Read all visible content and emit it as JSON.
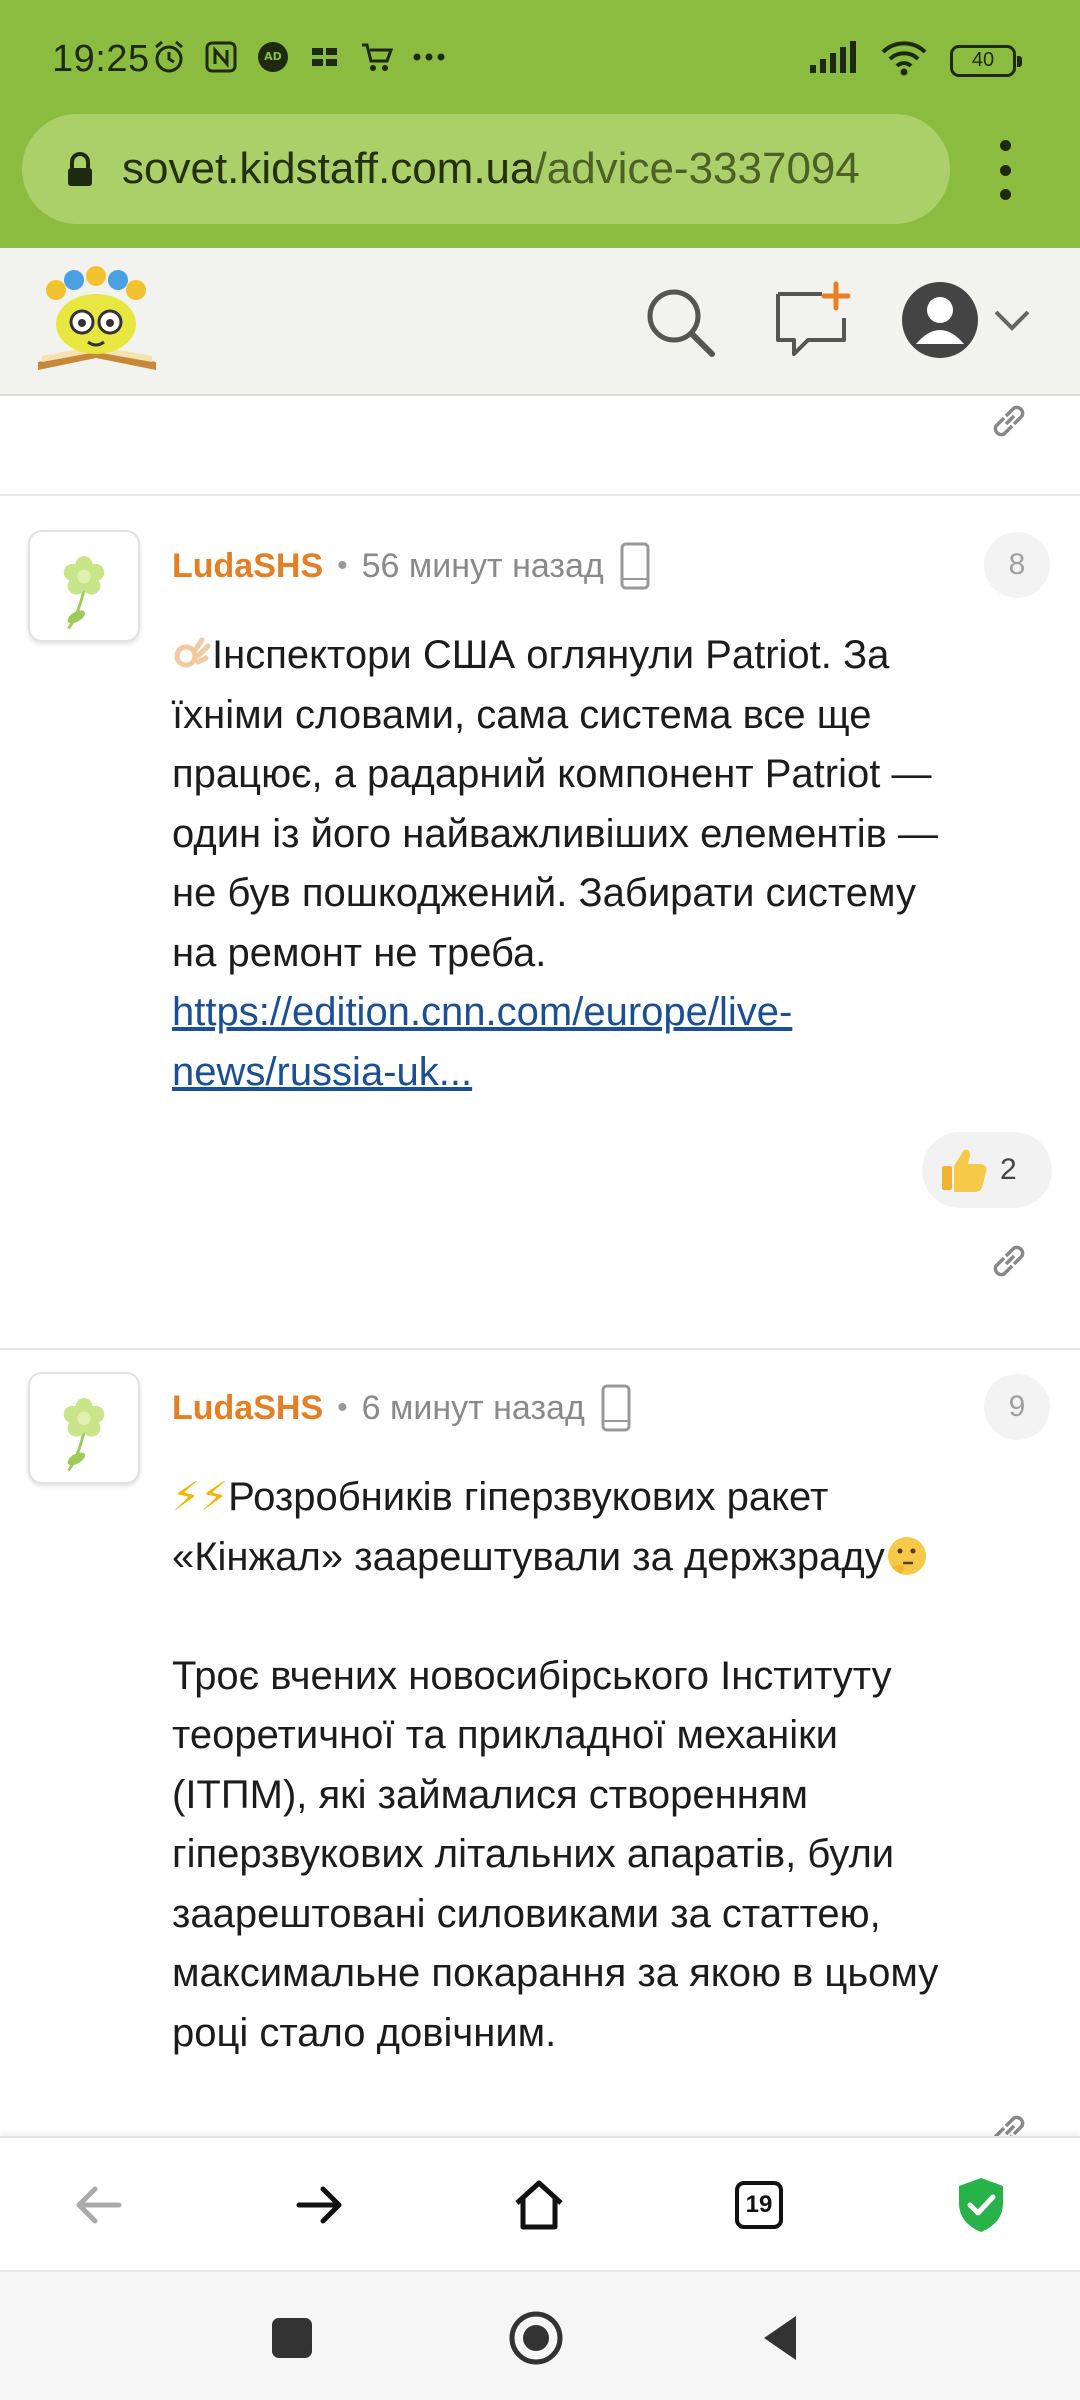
{
  "status_bar": {
    "time": "19:25",
    "battery": "40",
    "left_icons": [
      "alarm-icon",
      "nfc-icon",
      "adblock-icon",
      "app-icon",
      "cart-icon",
      "more-dots-icon"
    ],
    "right_icons": [
      "signal-icon",
      "wifi-icon",
      "battery-icon"
    ]
  },
  "browser": {
    "url_domain": "sovet.kidstaff.com.ua",
    "url_path": "/advice-3337094"
  },
  "header": {
    "logo": "kidstaff-logo",
    "icons": [
      "search-icon",
      "new-message-icon",
      "user-avatar-icon",
      "chevron-down-icon"
    ]
  },
  "comments": [
    {
      "author": "LudaSHS",
      "separator": "•",
      "time": "56 минут назад",
      "number": "8",
      "text_lines": [
        "Інспектори США оглянули Patriot. За",
        "їхніми словами, сама система все ще",
        "працює, а радарний компонент Patriot —",
        "один із його найважливіших елементів —",
        "не був пошкоджений. Забирати систему",
        "на ремонт не треба."
      ],
      "link_line1": "https://edition.cnn.com/europe/live-",
      "link_line2": "news/russia-uk...",
      "reaction_count": "2"
    },
    {
      "author": "LudaSHS",
      "separator": "•",
      "time": "6 минут назад",
      "number": "9",
      "headline_prefix": "⚡⚡",
      "headline_line1": "Розробників гіперзвукових ракет",
      "headline_line2": "«Кінжал» заарештували за держзраду",
      "body_lines": [
        "Троє вчених новосибірського Інституту",
        "теоретичної та прикладної механіки",
        "(ІТПМ), які займалися створенням",
        "гіперзвукових літальних апаратів, були",
        "заарештовані силовиками за статтею,",
        "максимальне покарання за якою в цьому",
        "році стало довічним."
      ]
    }
  ],
  "toolbar": {
    "tabs_count": "19",
    "accent": "#27b24a"
  },
  "colors": {
    "browser_bar": "#8cbc3f",
    "author": "#e67e22",
    "link": "#1a4f96"
  }
}
